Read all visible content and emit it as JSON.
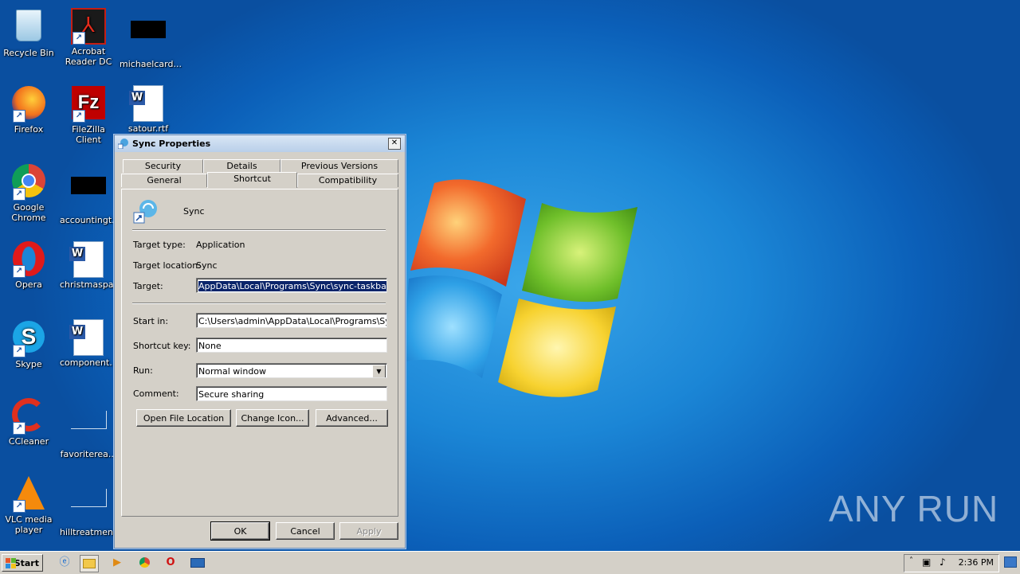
{
  "desktop": {
    "icons": [
      {
        "label": "Recycle Bin",
        "icon": "recycle-bin-icon"
      },
      {
        "label": "Acrobat Reader DC",
        "icon": "acrobat-icon"
      },
      {
        "label": "michaelcard...",
        "icon": "file-icon"
      },
      {
        "label": "Firefox",
        "icon": "firefox-icon"
      },
      {
        "label": "FileZilla Client",
        "icon": "filezilla-icon"
      },
      {
        "label": "satour.rtf",
        "icon": "word-doc-icon"
      },
      {
        "label": "Google Chrome",
        "icon": "chrome-icon"
      },
      {
        "label": "accountingt...",
        "icon": "file-icon"
      },
      {
        "label": "Opera",
        "icon": "opera-icon"
      },
      {
        "label": "christmaspa...",
        "icon": "word-doc-icon"
      },
      {
        "label": "Skype",
        "icon": "skype-icon"
      },
      {
        "label": "component...",
        "icon": "word-doc-icon"
      },
      {
        "label": "CCleaner",
        "icon": "ccleaner-icon"
      },
      {
        "label": "favoriterea...",
        "icon": "file-icon"
      },
      {
        "label": "VLC media player",
        "icon": "vlc-icon"
      },
      {
        "label": "hilltreatmen...",
        "icon": "file-icon"
      }
    ],
    "watermark": "ANY RUN"
  },
  "dialog": {
    "title": "Sync Properties",
    "close": "✕",
    "tabs_row1": [
      "Security",
      "Details",
      "Previous Versions"
    ],
    "tabs_row2": [
      "General",
      "Shortcut",
      "Compatibility"
    ],
    "active_tab": "Shortcut",
    "app_name": "Sync",
    "target_type_label": "Target type:",
    "target_type_value": "Application",
    "target_location_label": "Target location:",
    "target_location_value": "Sync",
    "target_label": "Target:",
    "target_value": "AppData\\Local\\Programs\\Sync\\sync-taskbar.exe",
    "start_in_label": "Start in:",
    "start_in_value": "C:\\Users\\admin\\AppData\\Local\\Programs\\Sync\\",
    "shortcut_key_label": "Shortcut key:",
    "shortcut_key_value": "None",
    "run_label": "Run:",
    "run_value": "Normal window",
    "comment_label": "Comment:",
    "comment_value": "Secure sharing",
    "open_file_location": "Open File Location",
    "change_icon": "Change Icon...",
    "advanced": "Advanced...",
    "ok": "OK",
    "cancel": "Cancel",
    "apply": "Apply"
  },
  "taskbar": {
    "start": "Start",
    "clock": "2:36 PM",
    "pinned": [
      "internet-explorer-icon",
      "explorer-folder-icon",
      "media-player-icon",
      "chrome-icon",
      "opera-icon",
      "keyboard-icon"
    ]
  }
}
